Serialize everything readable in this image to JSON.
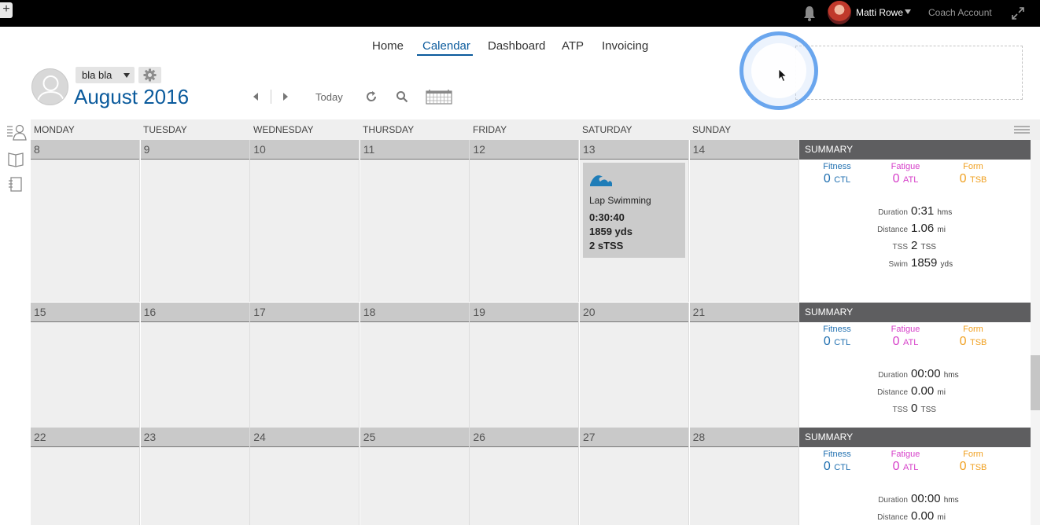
{
  "topbar": {
    "add_label": "+",
    "user_name": "Matti Rowe",
    "account_label": "Coach Account"
  },
  "nav": {
    "items": [
      "Home",
      "Calendar",
      "Dashboard",
      "ATP",
      "Invoicing"
    ],
    "active": "Calendar"
  },
  "header": {
    "athlete_select": "bla bla",
    "month": "August",
    "year": "2016",
    "today_label": "Today"
  },
  "calendar": {
    "day_headers": [
      "MONDAY",
      "TUESDAY",
      "WEDNESDAY",
      "THURSDAY",
      "FRIDAY",
      "SATURDAY",
      "SUNDAY"
    ],
    "weeks": [
      {
        "days": [
          "8",
          "9",
          "10",
          "11",
          "12",
          "13",
          "14"
        ],
        "summary": {
          "title": "SUMMARY",
          "fitness_label": "Fitness",
          "fitness_value": "0",
          "fitness_unit": "CTL",
          "fatigue_label": "Fatigue",
          "fatigue_value": "0",
          "fatigue_unit": "ATL",
          "form_label": "Form",
          "form_value": "0",
          "form_unit": "TSB",
          "stats": [
            {
              "label": "Duration",
              "value": "0:31",
              "unit": "hms"
            },
            {
              "label": "Distance",
              "value": "1.06",
              "unit": "mi"
            },
            {
              "label": "TSS",
              "value": "2",
              "unit": "TSS"
            },
            {
              "label": "Swim",
              "value": "1859",
              "unit": "yds"
            }
          ]
        }
      },
      {
        "days": [
          "15",
          "16",
          "17",
          "18",
          "19",
          "20",
          "21"
        ],
        "summary": {
          "title": "SUMMARY",
          "fitness_label": "Fitness",
          "fitness_value": "0",
          "fitness_unit": "CTL",
          "fatigue_label": "Fatigue",
          "fatigue_value": "0",
          "fatigue_unit": "ATL",
          "form_label": "Form",
          "form_value": "0",
          "form_unit": "TSB",
          "stats": [
            {
              "label": "Duration",
              "value": "00:00",
              "unit": "hms"
            },
            {
              "label": "Distance",
              "value": "0.00",
              "unit": "mi"
            },
            {
              "label": "TSS",
              "value": "0",
              "unit": "TSS"
            }
          ]
        }
      },
      {
        "days": [
          "22",
          "23",
          "24",
          "25",
          "26",
          "27",
          "28"
        ],
        "summary": {
          "title": "SUMMARY",
          "fitness_label": "Fitness",
          "fitness_value": "0",
          "fitness_unit": "CTL",
          "fatigue_label": "Fatigue",
          "fatigue_value": "0",
          "fatigue_unit": "ATL",
          "form_label": "Form",
          "form_value": "0",
          "form_unit": "TSB",
          "stats": [
            {
              "label": "Duration",
              "value": "00:00",
              "unit": "hms"
            },
            {
              "label": "Distance",
              "value": "0.00",
              "unit": "mi"
            }
          ]
        }
      }
    ]
  },
  "workout": {
    "icon": "swim-wave-icon",
    "title": "Lap Swimming",
    "duration": "0:30:40",
    "distance": "1859 yds",
    "tss": "2 sTSS"
  },
  "colors": {
    "accent": "#0a5a9c",
    "fitness": "#1f6fb0",
    "fatigue": "#d63fc9",
    "form": "#f0a020",
    "summary_bar": "#5e5e60"
  }
}
